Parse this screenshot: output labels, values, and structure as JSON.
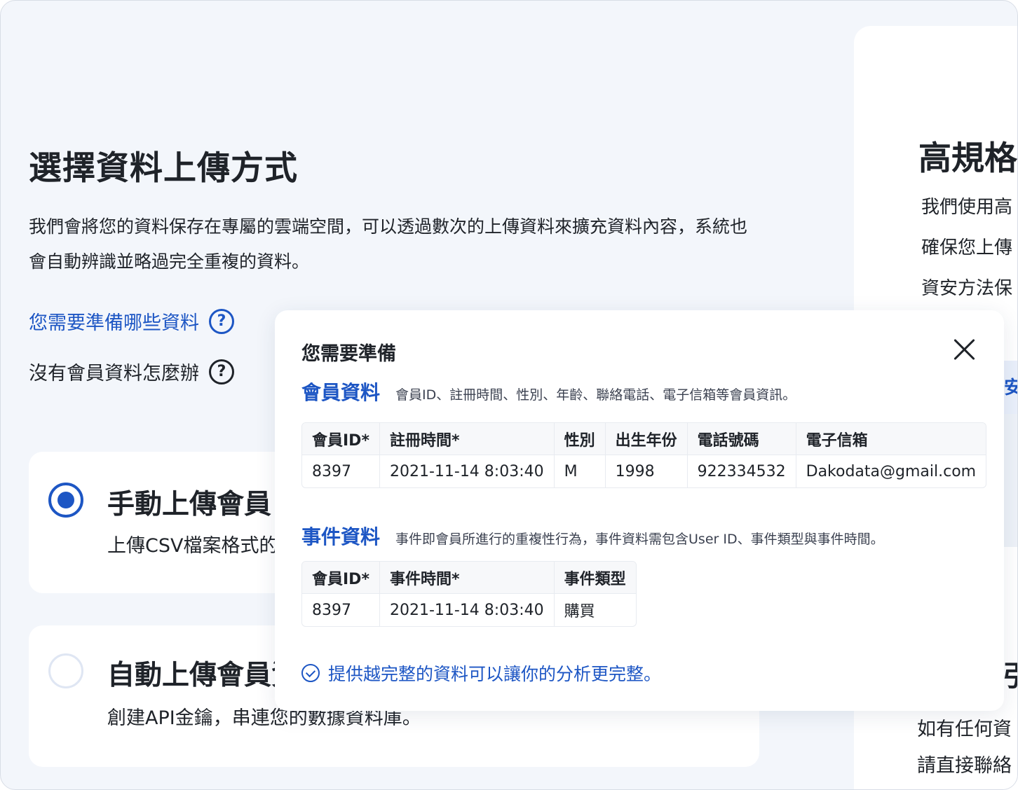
{
  "page": {
    "title": "選擇資料上傳方式",
    "description": "我們會將您的資料保存在專屬的雲端空間，可以透過數次的上傳資料來擴充資料內容，系統也會自動辨識並略過完全重複的資料。",
    "help_link": "您需要準備哪些資料",
    "help_plain": "沒有會員資料怎麼辦",
    "help_icon_glyph": "?"
  },
  "options": [
    {
      "title": "手動上傳會員",
      "desc": "上傳CSV檔案格式的",
      "selected": true
    },
    {
      "title": "自動上傳會員資",
      "desc": "創建API金鑰，串連您的數據資料庫。",
      "selected": false
    }
  ],
  "right_panel": {
    "title": "高規格",
    "lines": [
      "我們使用高",
      "確保您上傳",
      "資安方法保"
    ],
    "tab_label": "安",
    "heading2": "引",
    "footer_lines": [
      "如有任何資",
      "請直接聯絡"
    ]
  },
  "popover": {
    "title": "您需要準備",
    "member": {
      "title": "會員資料",
      "desc": "會員ID、註冊時間、性別、年齡、聯絡電話、電子信箱等會員資訊。",
      "columns": [
        "會員ID*",
        "註冊時間*",
        "性別",
        "出生年份",
        "電話號碼",
        "電子信箱"
      ],
      "row": [
        "8397",
        "2021-11-14 8:03:40",
        "M",
        "1998",
        "922334532",
        "Dakodata@gmail.com"
      ]
    },
    "event": {
      "title": "事件資料",
      "desc": "事件即會員所進行的重複性行為，事件資料需包含User ID、事件類型與事件時間。",
      "columns": [
        "會員ID*",
        "事件時間*",
        "事件類型"
      ],
      "row": [
        "8397",
        "2021-11-14 8:03:40",
        "購買"
      ]
    },
    "footer_note": "提供越完整的資料可以讓你的分析更完整。"
  },
  "colors": {
    "accent": "#1d56c4",
    "background": "#f3f6fb",
    "card": "#ffffff",
    "text": "#1f2329"
  }
}
